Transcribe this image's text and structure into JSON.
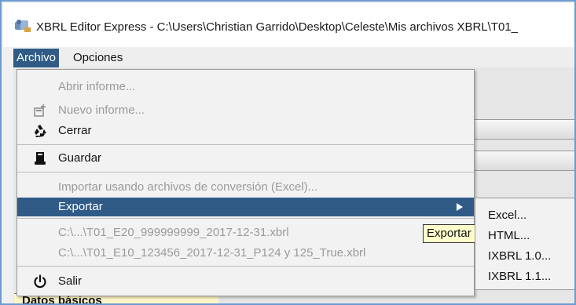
{
  "window": {
    "title": "XBRL Editor Express - C:\\Users\\Christian Garrido\\Desktop\\Celeste\\Mis archivos XBRL\\T01_",
    "app_icon": "xbrl-app-icon"
  },
  "menubar": {
    "items": [
      {
        "label": "Archivo",
        "active": true
      },
      {
        "label": "Opciones",
        "active": false
      }
    ]
  },
  "archivo_menu": {
    "abrir": "Abrir informe...",
    "nuevo": "Nuevo informe...",
    "cerrar": "Cerrar",
    "guardar": "Guardar",
    "importar": "Importar usando archivos de conversión (Excel)...",
    "exportar": "Exportar",
    "recent_1": "C:\\...\\T01_E20_999999999_2017-12-31.xbrl",
    "recent_2": "C:\\...\\T01_E10_123456_2017-12-31_P124 y 125_True.xbrl",
    "salir": "Salir",
    "icons": {
      "nuevo": "new-document-icon",
      "cerrar": "recycle-icon",
      "guardar": "save-icon",
      "salir": "power-icon"
    }
  },
  "tooltip": {
    "text": "Exportar"
  },
  "export_submenu": {
    "items": [
      "Excel...",
      "HTML...",
      "IXBRL 1.0...",
      "IXBRL 1.1..."
    ]
  },
  "background": {
    "partial_label": "Datos básicos"
  },
  "colors": {
    "highlight": "#2f5b86",
    "tooltip_bg": "#ffffcc",
    "disabled_text": "#9a9a9a"
  }
}
